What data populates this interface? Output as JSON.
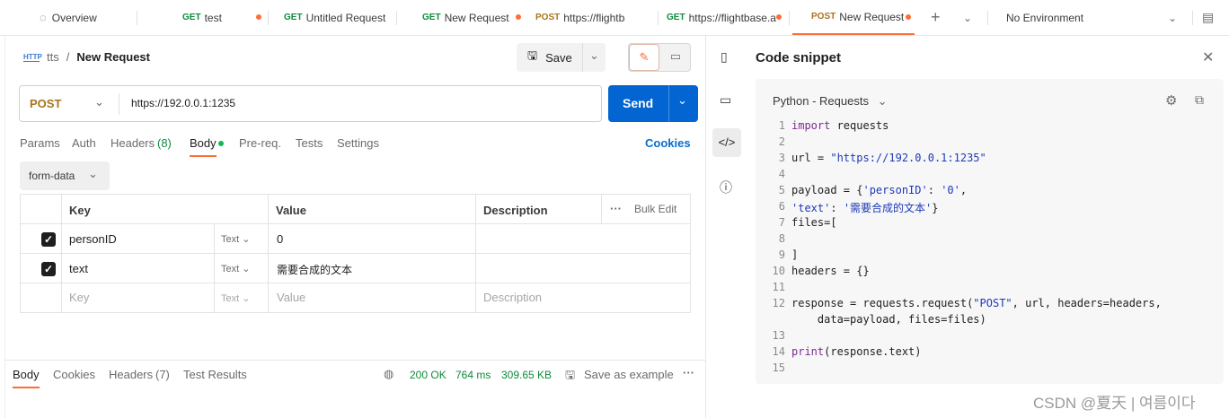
{
  "tabs": {
    "overview": "Overview",
    "items": [
      {
        "method": "GET",
        "label": "test"
      },
      {
        "method": "GET",
        "label": "Untitled Request"
      },
      {
        "method": "GET",
        "label": "New Request"
      },
      {
        "method": "POST",
        "label": "https://flightbase.a"
      },
      {
        "method": "GET",
        "label": "https://flightbase.a"
      },
      {
        "method": "POST",
        "label": "New Request"
      }
    ],
    "add_symbol": "+",
    "environment": "No Environment"
  },
  "breadcrumb": {
    "collection": "tts",
    "separator": "/",
    "request": "New Request"
  },
  "toolbar": {
    "save_label": "Save"
  },
  "request": {
    "method": "POST",
    "url": "https://192.0.0.1:1235",
    "send_label": "Send"
  },
  "subtabs": {
    "params": "Params",
    "auth": "Auth",
    "headers": "Headers",
    "headers_count": "(8)",
    "body": "Body",
    "prereq": "Pre-req.",
    "tests": "Tests",
    "settings": "Settings",
    "cookies": "Cookies"
  },
  "body_type": "form-data",
  "table": {
    "headers": {
      "key": "Key",
      "value": "Value",
      "description": "Description",
      "bulk_edit": "Bulk Edit"
    },
    "rows": [
      {
        "key": "personID",
        "type": "Text",
        "value": "0"
      },
      {
        "key": "text",
        "type": "Text",
        "value": "需要合成的文本"
      }
    ],
    "placeholder": {
      "key": "Key",
      "type": "Text",
      "value": "Value",
      "description": "Description"
    }
  },
  "response": {
    "tabs": {
      "body": "Body",
      "cookies": "Cookies",
      "headers": "Headers",
      "headers_count": "(7)",
      "test_results": "Test Results"
    },
    "status": "200 OK",
    "time": "764 ms",
    "size": "309.65 KB",
    "save_example": "Save as example"
  },
  "snippet": {
    "title": "Code snippet",
    "language": "Python - Requests",
    "line_numbers": [
      "1",
      "2",
      "3",
      "4",
      "5",
      "6",
      "7",
      "8",
      "9",
      "10",
      "11",
      "12",
      "",
      "13",
      "14",
      "15"
    ]
  },
  "watermark": "CSDN @夏天 | 여름이다"
}
